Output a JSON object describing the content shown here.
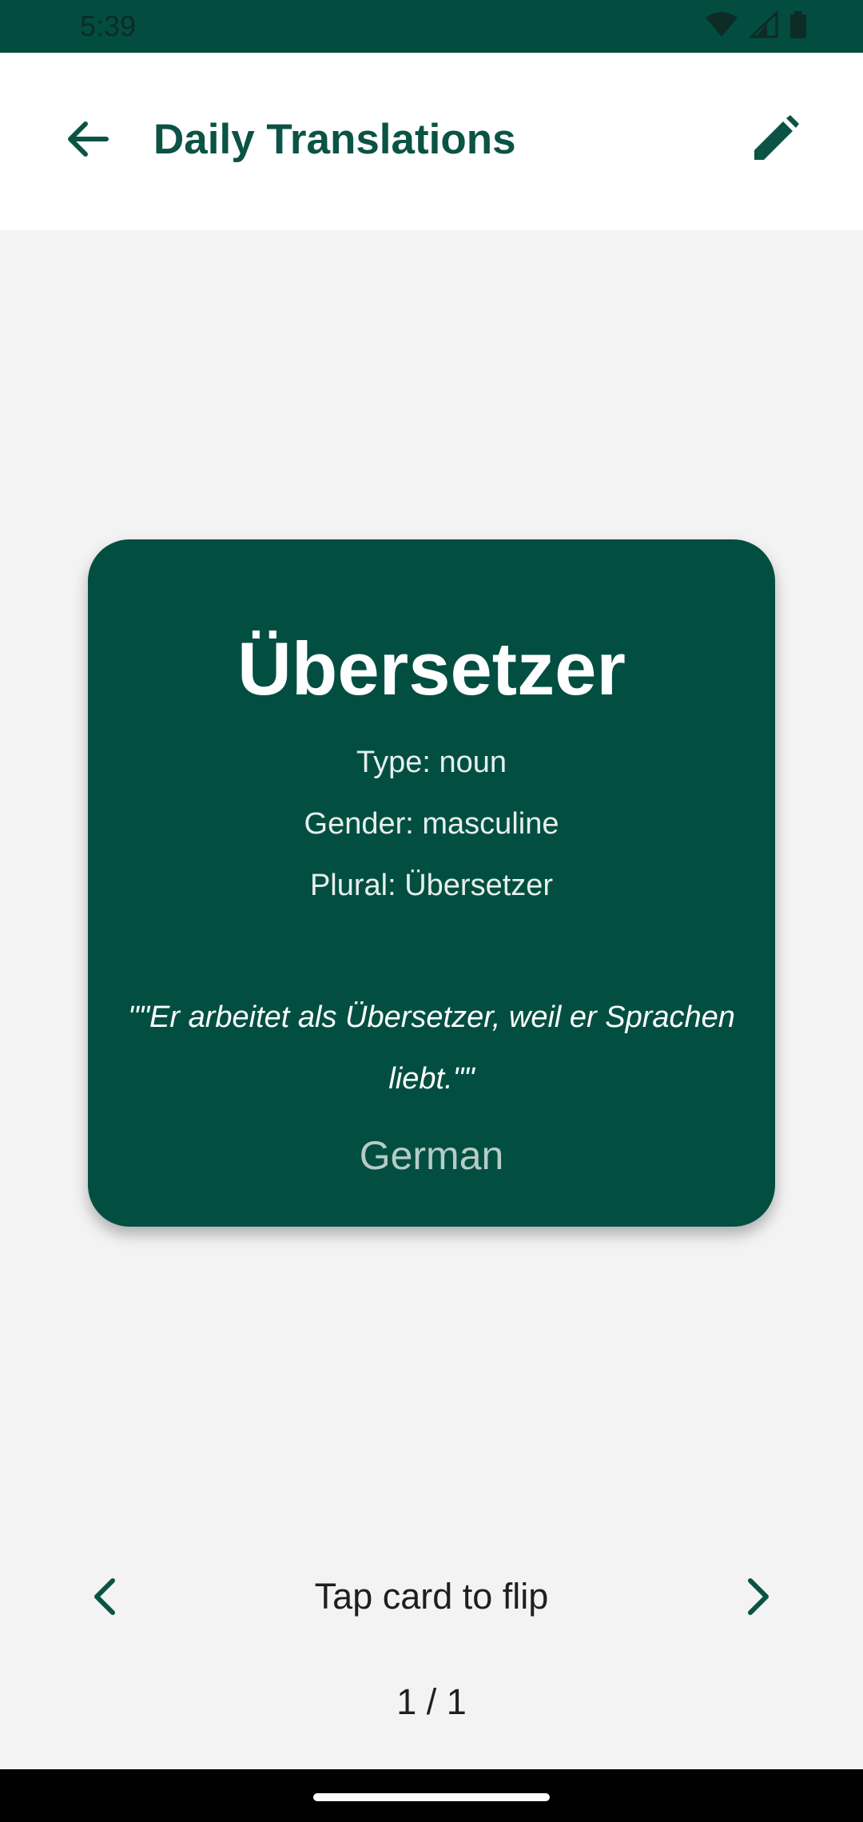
{
  "status_bar": {
    "time": "5:39",
    "icons": [
      "wifi-icon",
      "signal-icon",
      "battery-icon"
    ]
  },
  "app_bar": {
    "title": "Daily Translations",
    "back_icon": "arrow-back-icon",
    "edit_icon": "pencil-icon"
  },
  "card": {
    "word": "Übersetzer",
    "type": "Type: noun",
    "gender": "Gender: masculine",
    "plural": "Plural: Übersetzer",
    "example": "\"\"Er arbeitet als Übersetzer, weil er Sprachen liebt.\"\"",
    "language": "German"
  },
  "footer": {
    "hint": "Tap card to flip",
    "counter": "1 / 1"
  },
  "colors": {
    "primary": "#024f42",
    "status_bar": "#024d40",
    "background": "#f3f3f3",
    "accent_text": "#0b5345"
  }
}
